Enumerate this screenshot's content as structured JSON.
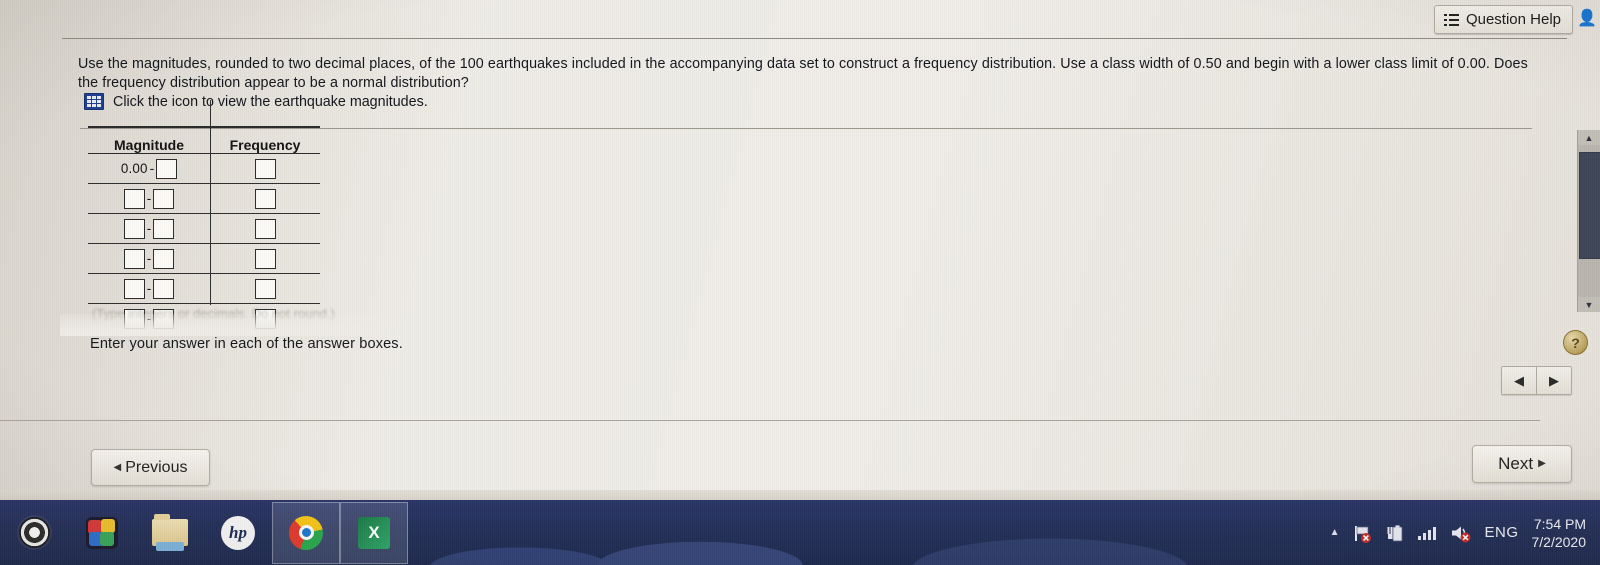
{
  "topbar": {
    "question_help_label": "Question Help",
    "help_icon": "list-icon",
    "person_icon": "person-icon"
  },
  "question": {
    "body": "Use the magnitudes, rounded to two decimal places, of the 100 earthquakes included in the accompanying data set to construct a frequency distribution. Use a class width of 0.50 and begin with a lower class limit of 0.00. Does the frequency distribution appear to be a normal distribution?",
    "data_link_text": "Click the icon to view the earthquake magnitudes.",
    "data_icon": "spreadsheet-grid-icon"
  },
  "table": {
    "headers": [
      "Magnitude",
      "Frequency"
    ],
    "rows": [
      {
        "lower": "0.00",
        "dash": "-",
        "upper": "",
        "frequency": "",
        "lower_is_fixed": true
      },
      {
        "lower": "",
        "dash": "-",
        "upper": "",
        "frequency": "",
        "lower_is_fixed": false
      },
      {
        "lower": "",
        "dash": "-",
        "upper": "",
        "frequency": "",
        "lower_is_fixed": false
      },
      {
        "lower": "",
        "dash": "-",
        "upper": "",
        "frequency": "",
        "lower_is_fixed": false
      },
      {
        "lower": "",
        "dash": "-",
        "upper": "",
        "frequency": "",
        "lower_is_fixed": false
      },
      {
        "lower": "",
        "dash": "-",
        "upper": "",
        "frequency": "",
        "lower_is_fixed": false
      }
    ],
    "note": "(Type integers or decimals. Do not round.)"
  },
  "instruction": "Enter your answer in each of the answer boxes.",
  "right_controls": {
    "scroll_up_icon": "caret-up-icon",
    "scroll_down_icon": "caret-down-icon",
    "help_badge": "?",
    "prev_arrow": "◀",
    "next_arrow": "▶"
  },
  "footer": {
    "previous_label": "Previous",
    "previous_arrow": "◀",
    "next_label": "Next",
    "next_arrow": "▶"
  },
  "taskbar": {
    "items": [
      {
        "name": "cortana",
        "label": ""
      },
      {
        "name": "microsoft-store",
        "label": ""
      },
      {
        "name": "file-explorer",
        "label": ""
      },
      {
        "name": "hp-support",
        "label": "hp"
      },
      {
        "name": "google-chrome",
        "label": ""
      },
      {
        "name": "microsoft-excel",
        "label": "X"
      }
    ],
    "tray": {
      "show_hidden_icon": "caret-up-icon",
      "flag_icon": "flag-alert-icon",
      "battery_icon": "battery-plug-icon",
      "network_icon": "signal-bars-icon",
      "volume_icon": "speaker-mute-icon",
      "language": "ENG",
      "time": "7:54 PM",
      "date": "7/2/2020"
    }
  },
  "colors": {
    "page_bg": "#efece6",
    "taskbar_bg": "#243059",
    "accent_blue": "#1f3f92",
    "text": "#13161c"
  }
}
